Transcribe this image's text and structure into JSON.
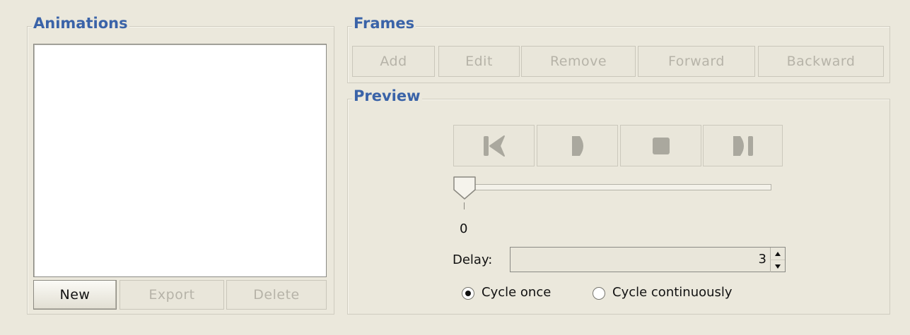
{
  "animations": {
    "title": "Animations",
    "items": [],
    "buttons": {
      "new": "New",
      "export": "Export",
      "delete": "Delete"
    }
  },
  "frames": {
    "title": "Frames",
    "buttons": {
      "add": "Add",
      "edit": "Edit",
      "remove": "Remove",
      "forward": "Forward",
      "backward": "Backward"
    }
  },
  "preview": {
    "title": "Preview",
    "controls": [
      "skip-to-start-icon",
      "play-icon",
      "stop-icon",
      "skip-to-end-icon"
    ],
    "slider": {
      "value": 0,
      "tick_label": "0"
    },
    "delay": {
      "label": "Delay:",
      "value": "3"
    },
    "cycle": {
      "once_label": "Cycle once",
      "continuous_label": "Cycle continuously",
      "selected": "once"
    }
  },
  "colors": {
    "title_blue": "#3a63a8",
    "background": "#ebe8dc",
    "disabled_text": "#b6b3a8",
    "icon_gray": "#aaa89e"
  }
}
